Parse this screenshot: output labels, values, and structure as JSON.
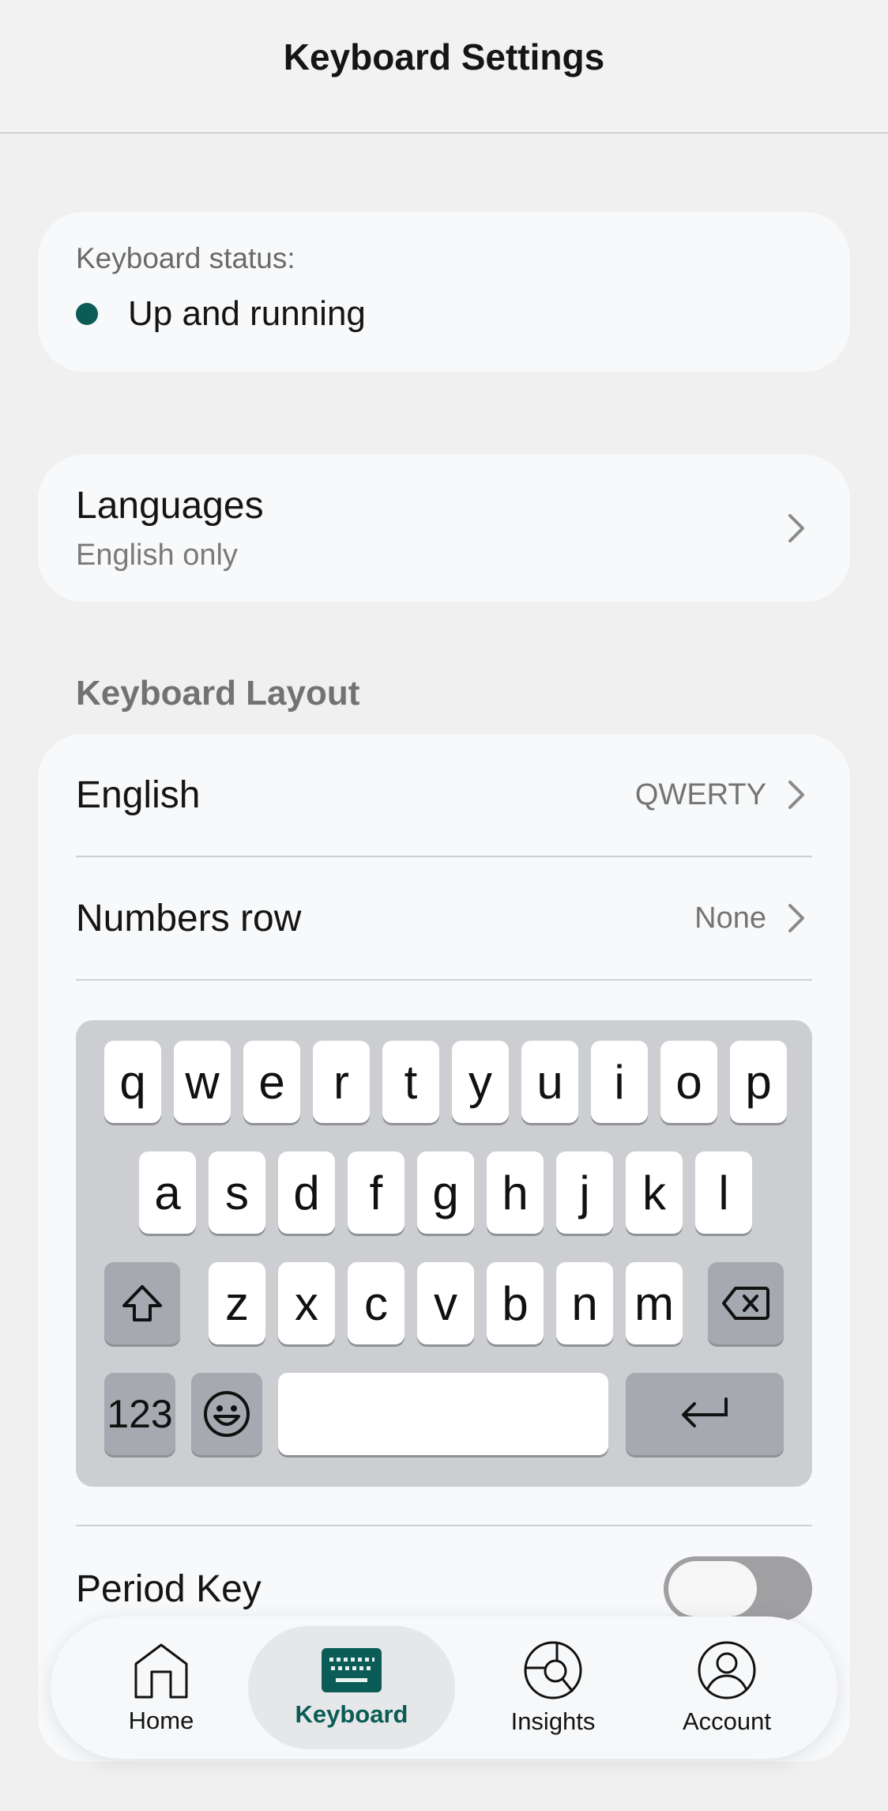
{
  "header": {
    "title": "Keyboard Settings"
  },
  "status": {
    "label": "Keyboard status:",
    "value": "Up and running",
    "dot_color": "#0b5c57"
  },
  "languages": {
    "title": "Languages",
    "subtitle": "English only"
  },
  "layout": {
    "section_title": "Keyboard Layout",
    "rows": [
      {
        "label": "English",
        "value": "QWERTY"
      },
      {
        "label": "Numbers row",
        "value": "None"
      }
    ],
    "keyboard": {
      "row1": [
        "q",
        "w",
        "e",
        "r",
        "t",
        "y",
        "u",
        "i",
        "o",
        "p"
      ],
      "row2": [
        "a",
        "s",
        "d",
        "f",
        "g",
        "h",
        "j",
        "k",
        "l"
      ],
      "row3": [
        "z",
        "x",
        "c",
        "v",
        "b",
        "n",
        "m"
      ],
      "numbers_key": "123"
    },
    "period_key": {
      "label": "Period Key",
      "enabled": false
    }
  },
  "nav": {
    "items": [
      {
        "label": "Home",
        "icon": "home-icon",
        "active": false
      },
      {
        "label": "Keyboard",
        "icon": "keyboard-icon",
        "active": true
      },
      {
        "label": "Insights",
        "icon": "insights-icon",
        "active": false
      },
      {
        "label": "Account",
        "icon": "account-icon",
        "active": false
      }
    ],
    "accent": "#0b5c57"
  }
}
